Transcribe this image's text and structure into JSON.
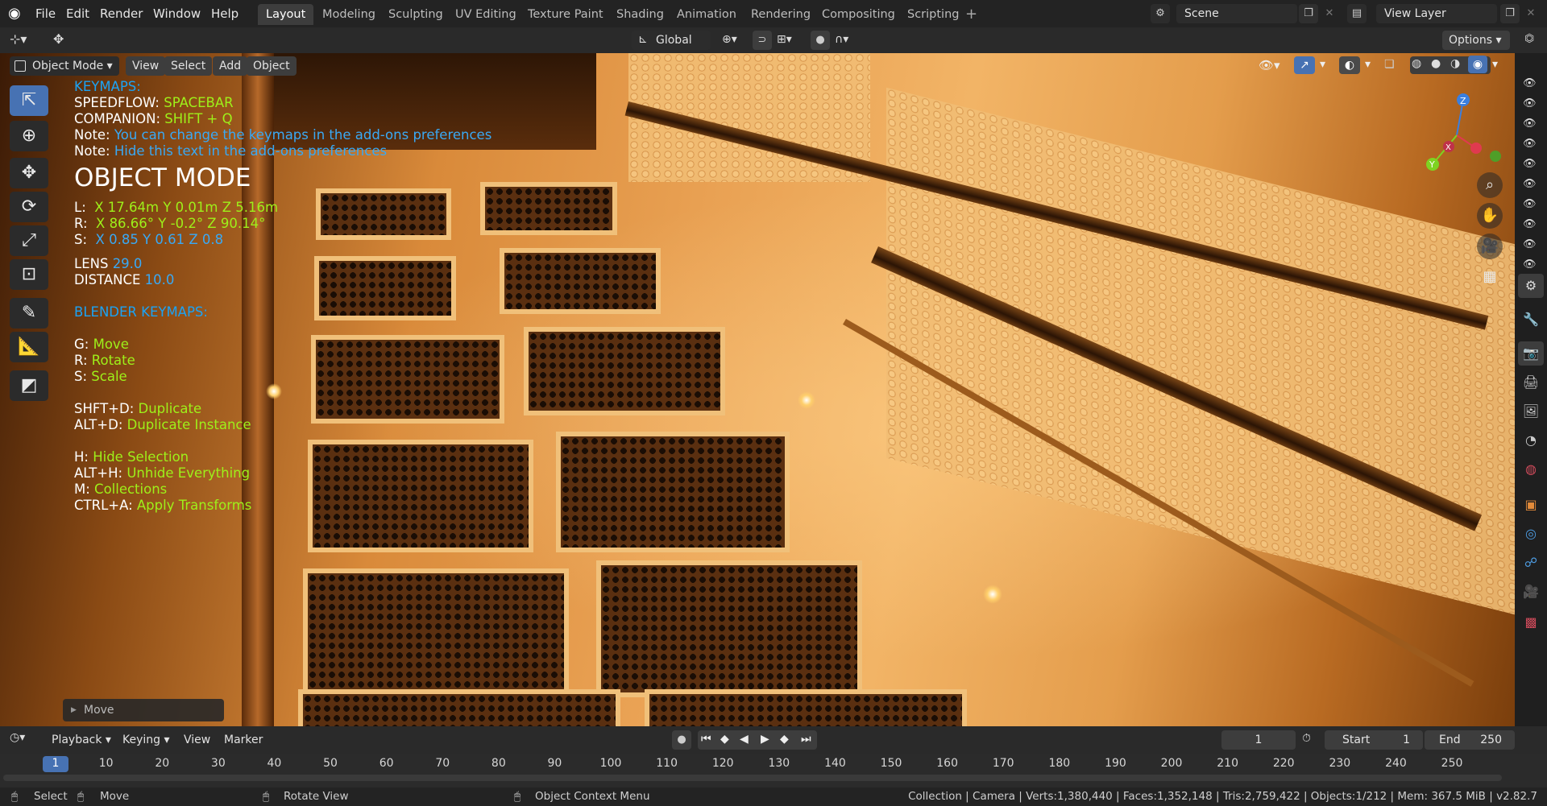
{
  "menu": [
    "File",
    "Edit",
    "Render",
    "Window",
    "Help"
  ],
  "workspaces": [
    "Layout",
    "Modeling",
    "Sculpting",
    "UV Editing",
    "Texture Paint",
    "Shading",
    "Animation",
    "Rendering",
    "Compositing",
    "Scripting"
  ],
  "scene": "Scene",
  "view_layer": "View Layer",
  "header": {
    "orientation": "Global",
    "options": "Options",
    "mode": "Object Mode",
    "view": "View",
    "select": "Select",
    "add": "Add",
    "object": "Object"
  },
  "overlay": {
    "keymaps_title": "KEYMAPS:",
    "speedflow_label": "SPEEDFLOW: ",
    "speedflow_key": "SPACEBAR",
    "companion_label": "COMPANION: ",
    "companion_key": "SHIFT + Q",
    "note_label": "Note: ",
    "note1": "You can change the keymaps in the add-ons preferences",
    "note2": "Hide this text in the add-ons preferences",
    "mode_title": "OBJECT MODE",
    "loc_label": "L:  ",
    "loc_value": "X 17.64m Y 0.01m Z 5.16m",
    "rot_label": "R:  ",
    "rot_value": "X 86.66° Y -0.2° Z 90.14°",
    "scale_label": "S:  ",
    "scale_value": "X 0.85 Y 0.61 Z 0.8",
    "lens_label": "LENS ",
    "lens_value": "29.0",
    "distance_label": "DISTANCE ",
    "distance_value": "10.0",
    "blender_keymaps": "BLENDER KEYMAPS:",
    "keys": [
      {
        "k": "G: ",
        "v": "Move"
      },
      {
        "k": "R: ",
        "v": "Rotate"
      },
      {
        "k": "S: ",
        "v": "Scale"
      },
      {
        "k": "SHFT+D: ",
        "v": "Duplicate"
      },
      {
        "k": "ALT+D: ",
        "v": "Duplicate Instance"
      },
      {
        "k": "H: ",
        "v": "Hide Selection"
      },
      {
        "k": "ALT+H: ",
        "v": "Unhide Everything"
      },
      {
        "k": "M: ",
        "v": "Collections"
      },
      {
        "k": "CTRL+A: ",
        "v": "Apply Transforms"
      }
    ]
  },
  "operator_panel": "Move",
  "gizmo": {
    "x": "X",
    "y": "Y",
    "z": "Z"
  },
  "timeline": {
    "playback": "Playback",
    "keying": "Keying",
    "view": "View",
    "marker": "Marker",
    "current_frame": "1",
    "start_label": "Start",
    "start": "1",
    "end_label": "End",
    "end": "250",
    "ticks": [
      "1",
      "10",
      "20",
      "30",
      "40",
      "50",
      "60",
      "70",
      "80",
      "90",
      "100",
      "110",
      "120",
      "130",
      "140",
      "150",
      "160",
      "170",
      "180",
      "190",
      "200",
      "210",
      "220",
      "230",
      "240",
      "250"
    ]
  },
  "status": {
    "select": "Select",
    "move": "Move",
    "rotate": "Rotate View",
    "context": "Object Context Menu",
    "info": "Collection | Camera | Verts:1,380,440 | Faces:1,352,148 | Tris:2,759,422 | Objects:1/212 | Mem: 367.5 MiB | v2.82.7"
  },
  "colors": {
    "accent": "#4772b3",
    "overlay_key": "#9ef01a",
    "overlay_note": "#39a9f5"
  }
}
